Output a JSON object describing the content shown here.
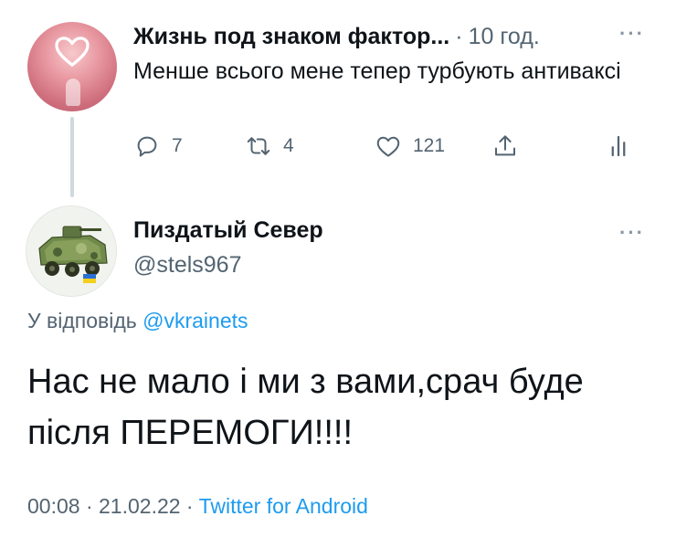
{
  "parent_tweet": {
    "author_name": "Жизнь под знаком фактор...",
    "separator": "·",
    "time": "10 год.",
    "text": "Менше всього мене тепер турбують антиваксі",
    "actions": {
      "reply_count": "7",
      "retweet_count": "4",
      "like_count": "121"
    }
  },
  "main_tweet": {
    "author_name": "Пиздатый Север",
    "handle": "@stels967",
    "reply_prefix": "У відповідь ",
    "reply_mention": "@vkrainets",
    "text": "Нас не мало і ми з вами,срач буде після ПЕРЕМОГИ!!!!",
    "time": "00:08",
    "separator1": " · ",
    "date": "21.02.22",
    "separator2": " · ",
    "source": "Twitter for Android"
  },
  "colors": {
    "text_primary": "#0f1419",
    "text_secondary": "#536471",
    "link_blue": "#1d9bf0",
    "thread_line": "#cfd9de"
  },
  "icons": [
    "heart-neon-icon",
    "reply-icon",
    "retweet-icon",
    "like-icon",
    "share-icon",
    "analytics-icon",
    "more-icon"
  ]
}
